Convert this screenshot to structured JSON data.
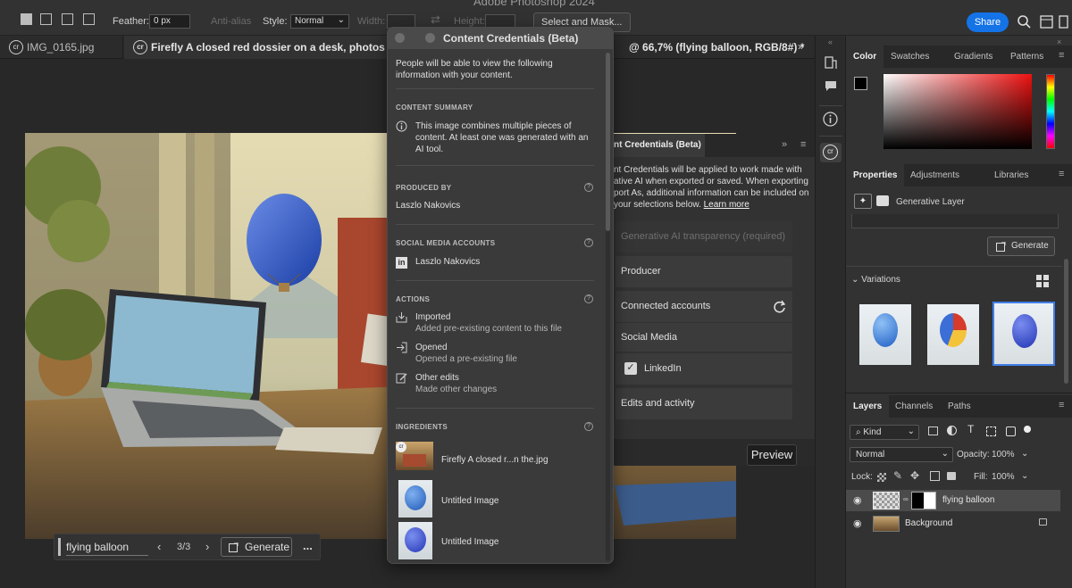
{
  "app": {
    "title": "Adobe Photoshop 2024"
  },
  "options_bar": {
    "feather_label": "Feather:",
    "feather_value": "0 px",
    "anti_alias_label": "Anti-alias",
    "style_label": "Style:",
    "style_value": "Normal",
    "width_label": "Width:",
    "height_label": "Height:",
    "select_mask_label": "Select and Mask...",
    "share_label": "Share"
  },
  "doc_tabs": [
    {
      "label": "IMG_0165.jpg"
    },
    {
      "label": "Firefly A closed red dossier on a desk, photos corner"
    },
    {
      "label": "@ 66,7% (flying balloon, RGB/8#) *"
    }
  ],
  "generate_bar": {
    "prompt_value": "flying balloon",
    "counter": "3/3",
    "generate_label": "Generate",
    "more_label": "..."
  },
  "cc_dialog": {
    "title": "Content Credentials (Beta)",
    "intro": "People will be able to view the following information with your content.",
    "summary_heading": "CONTENT SUMMARY",
    "summary_text": "This image combines multiple pieces of content. At least one was generated with an AI tool.",
    "produced_heading": "PRODUCED BY",
    "producer": "Laszlo Nakovics",
    "social_heading": "SOCIAL MEDIA ACCOUNTS",
    "social_name": "Laszlo Nakovics",
    "actions_heading": "ACTIONS",
    "actions": [
      {
        "title": "Imported",
        "desc": "Added pre-existing content to this file"
      },
      {
        "title": "Opened",
        "desc": "Opened a pre-existing file"
      },
      {
        "title": "Other edits",
        "desc": "Made other changes"
      }
    ],
    "ingredients_heading": "INGREDIENTS",
    "ingredients": [
      {
        "label": "Firefly A closed r...n the.jpg"
      },
      {
        "label": "Untitled Image"
      },
      {
        "label": "Untitled Image"
      }
    ]
  },
  "cc_panel": {
    "tab_label": "nt Credentials (Beta)",
    "description": "nt Credentials will be applied to work made with ative AI when exported or saved. When exporting port As, additional information can be included on your selections below.",
    "learn_more": "Learn more",
    "rows": {
      "transparency": "Generative AI transparency (required)",
      "producer": "Producer",
      "connected": "Connected accounts",
      "social": "Social Media",
      "linkedin": "LinkedIn",
      "edits": "Edits and activity"
    },
    "preview_label": "Preview"
  },
  "color_panel": {
    "tabs": [
      "Color",
      "Swatches",
      "Gradients",
      "Patterns"
    ]
  },
  "properties_panel": {
    "tabs": [
      "Properties",
      "Adjustments",
      "Libraries"
    ],
    "layer_type": "Generative Layer",
    "generate_label": "Generate",
    "variations_label": "Variations"
  },
  "layers_panel": {
    "tabs": [
      "Layers",
      "Channels",
      "Paths"
    ],
    "filter_kind": "Kind",
    "blend_mode": "Normal",
    "opacity_label": "Opacity:",
    "opacity_value": "100%",
    "lock_label": "Lock:",
    "fill_label": "Fill:",
    "fill_value": "100%",
    "layers": [
      {
        "name": "flying balloon"
      },
      {
        "name": "Background"
      }
    ]
  }
}
